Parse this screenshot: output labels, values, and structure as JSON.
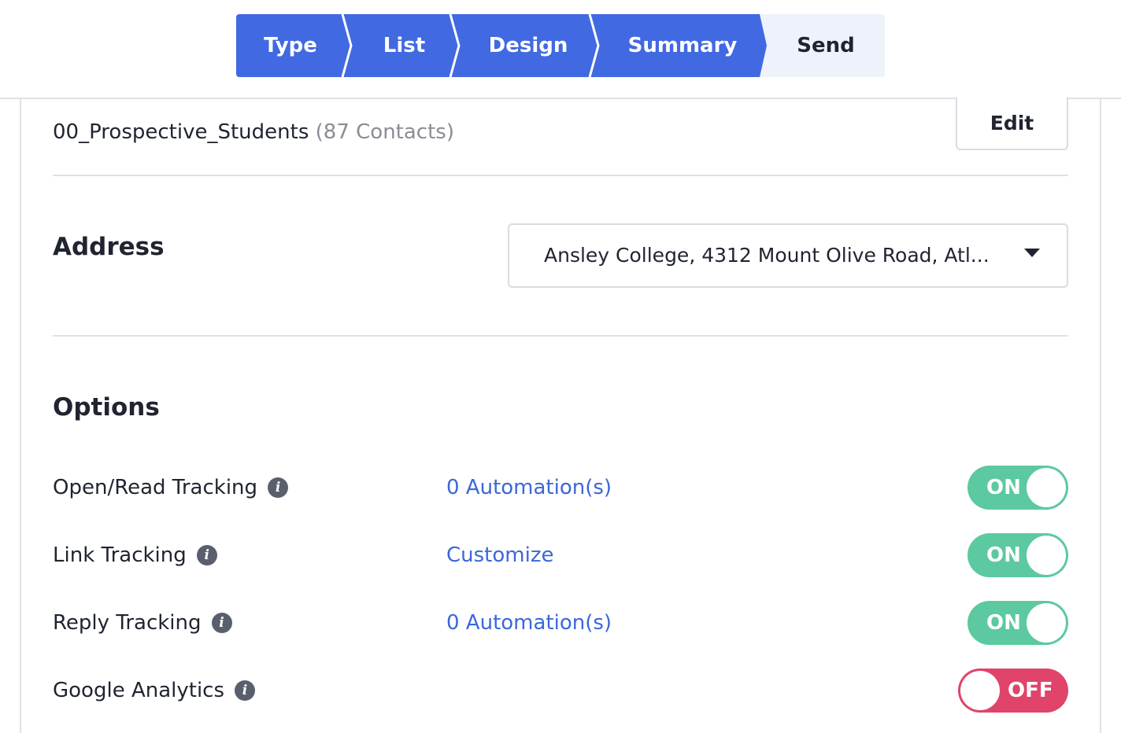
{
  "wizard": {
    "steps": [
      {
        "label": "Type",
        "state": "done"
      },
      {
        "label": "List",
        "state": "done"
      },
      {
        "label": "Design",
        "state": "done"
      },
      {
        "label": "Summary",
        "state": "done"
      },
      {
        "label": "Send",
        "state": "current"
      }
    ],
    "colors": {
      "done": "#4169e1",
      "current": "#eef2fb"
    }
  },
  "list": {
    "name": "00_Prospective_Students",
    "count": "(87 Contacts)",
    "edit_label": "Edit"
  },
  "address": {
    "title": "Address",
    "selected": "Ansley College, 4312 Mount Olive Road, Atl..."
  },
  "options": {
    "title": "Options",
    "items": [
      {
        "label": "Open/Read Tracking",
        "link": "0 Automation(s)",
        "toggle": "ON",
        "enabled": true
      },
      {
        "label": "Link Tracking",
        "link": "Customize",
        "toggle": "ON",
        "enabled": true
      },
      {
        "label": "Reply Tracking",
        "link": "0 Automation(s)",
        "toggle": "ON",
        "enabled": true
      },
      {
        "label": "Google Analytics",
        "link": "",
        "toggle": "OFF",
        "enabled": false
      }
    ],
    "colors": {
      "on": "#5cc9a0",
      "off": "#e0446a",
      "link": "#3c67d8"
    }
  }
}
